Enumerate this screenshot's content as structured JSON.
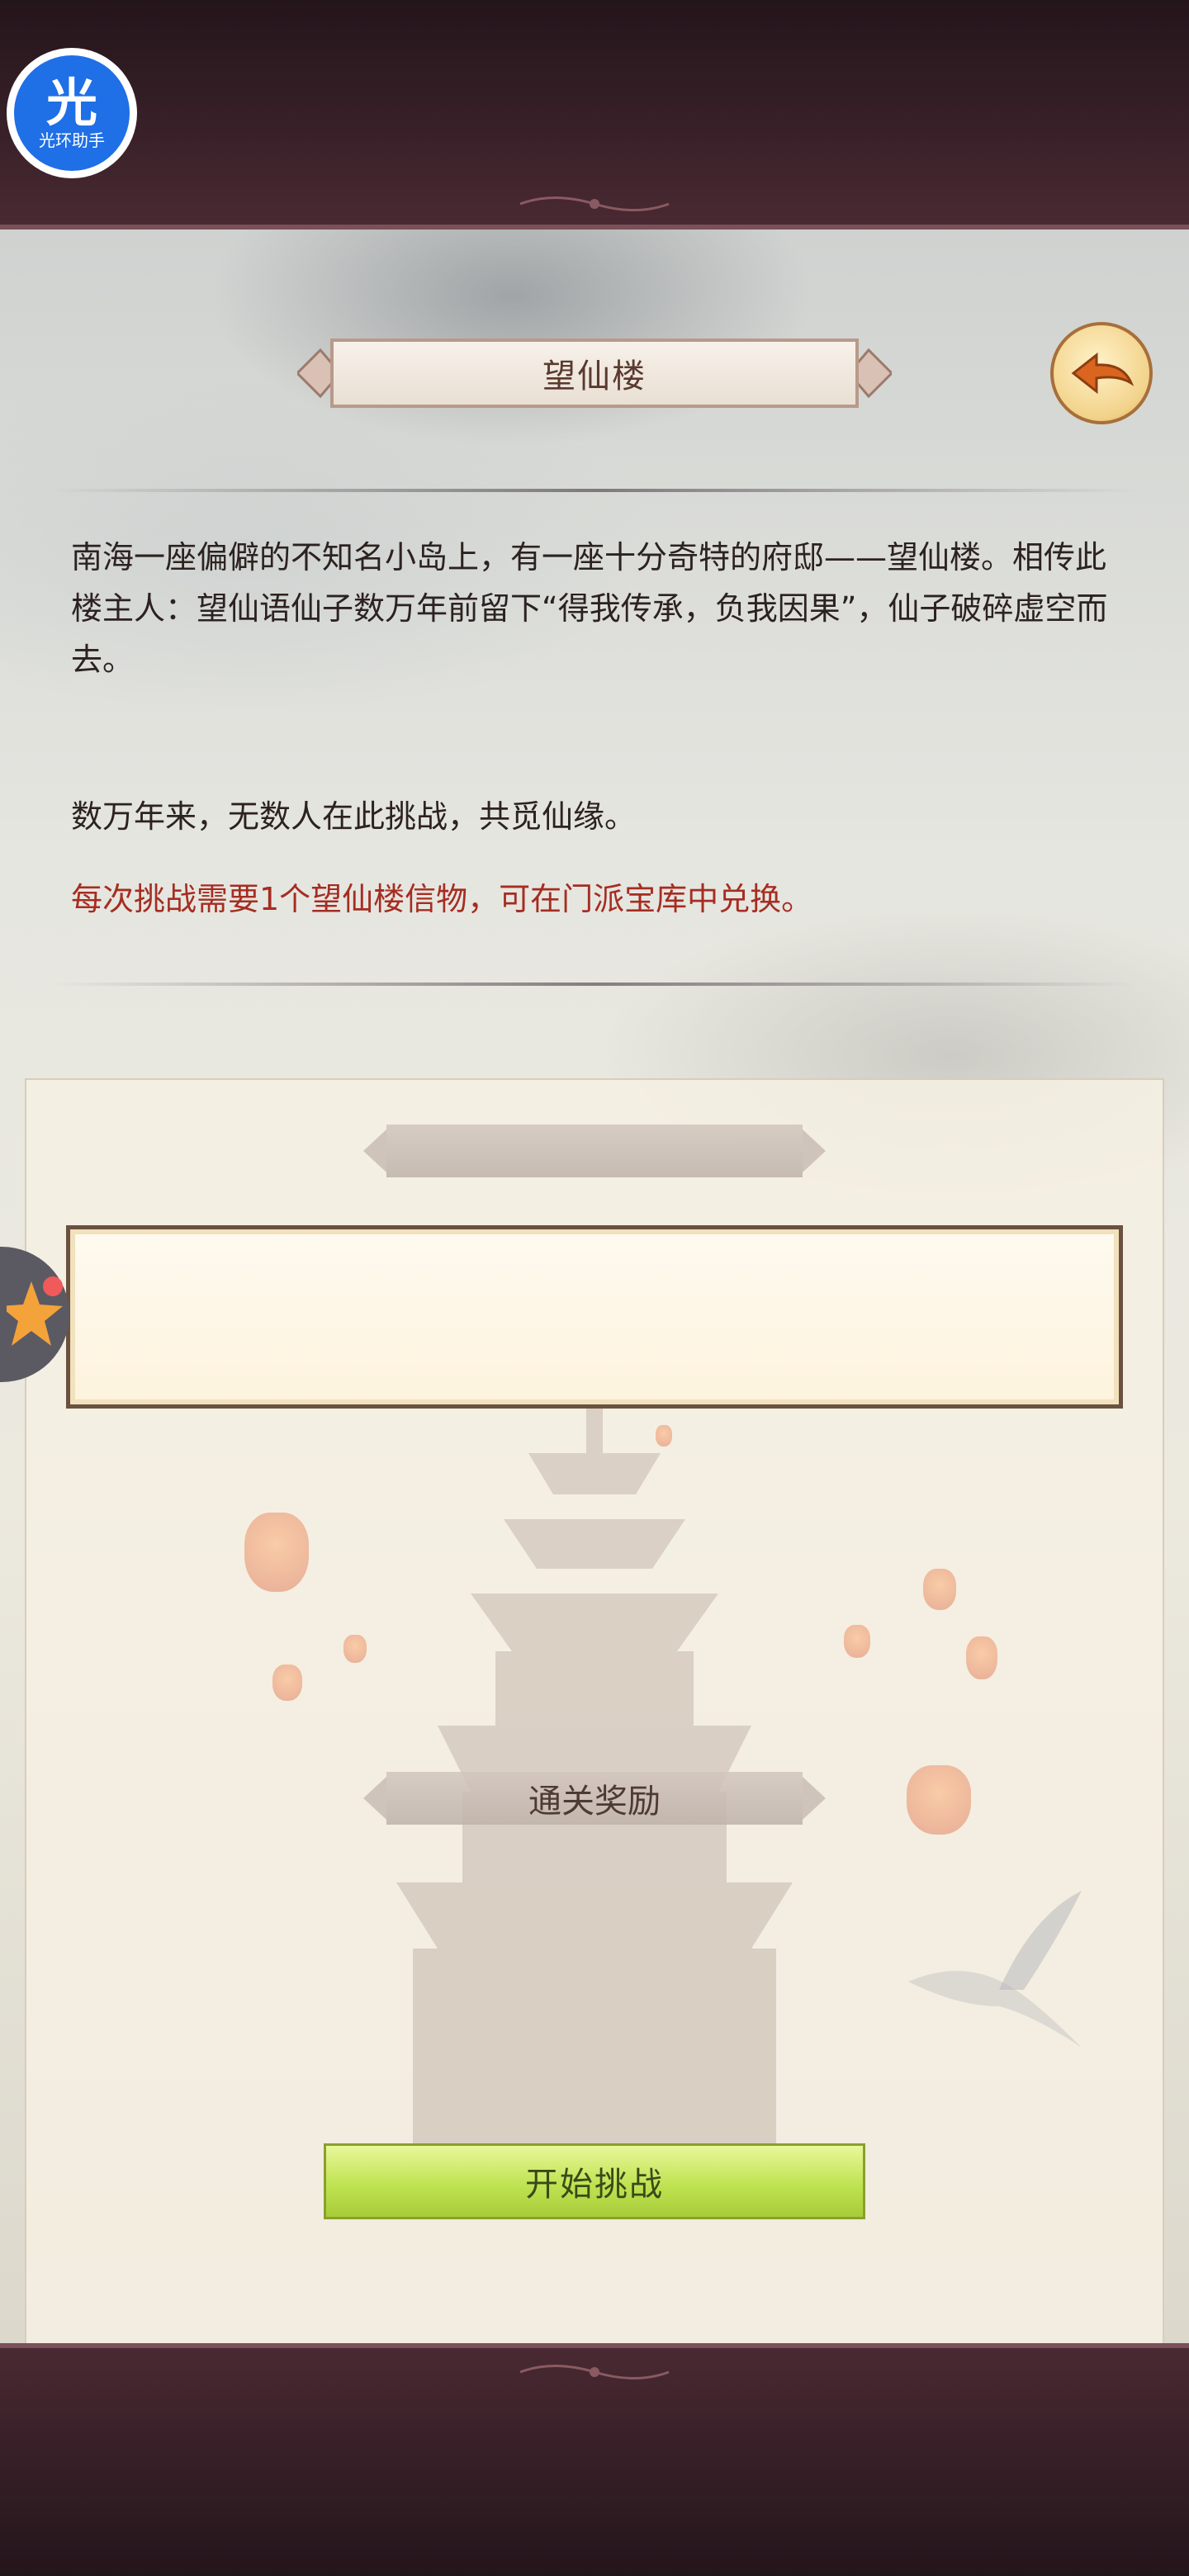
{
  "app_badge": {
    "glyph": "光",
    "label": "光环助手"
  },
  "header": {
    "title": "望仙楼",
    "back_icon": "back-arrow-icon"
  },
  "description": {
    "paragraph": "南海一座偏僻的不知名小岛上，有一座十分奇特的府邸——望仙楼。相传此楼主人：望仙语仙子数万年前留下“得我传承，负我因果”，仙子破碎虚空而去。",
    "line2": "数万年来，无数人在此挑战，共觅仙缘。",
    "notice": "每次挑战需要1个望仙楼信物，可在门派宝库中兑换。"
  },
  "panel": {
    "top_ribbon_label": "",
    "reward_ribbon_label": "通关奖励",
    "start_button_label": "开始挑战"
  },
  "colors": {
    "notice_text": "#a52d22",
    "button_green": "#bfe352",
    "frame_maroon": "#3a2129"
  }
}
